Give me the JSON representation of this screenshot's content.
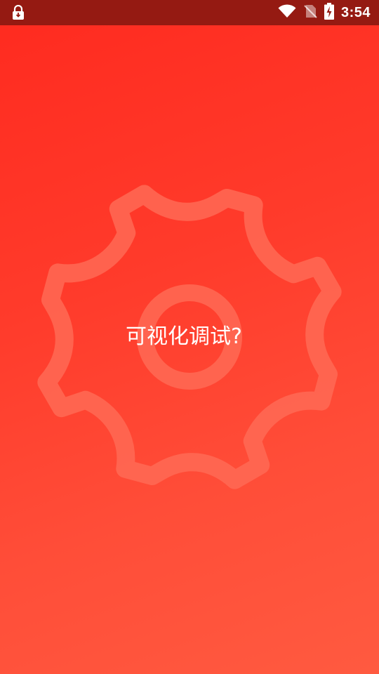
{
  "status_bar": {
    "time": "3:54",
    "icons": {
      "left": "lock-download-icon",
      "wifi": "wifi-icon",
      "sim": "no-sim-icon",
      "battery": "battery-charging-icon"
    }
  },
  "main": {
    "prompt": "可视化调试?",
    "background_icon": "gear-icon"
  },
  "colors": {
    "background_top": "#ff2a1f",
    "background_bottom": "#ff5a40",
    "status_bar": "#951a12",
    "gear_stroke": "#ff6a55",
    "text": "#ffffff"
  }
}
